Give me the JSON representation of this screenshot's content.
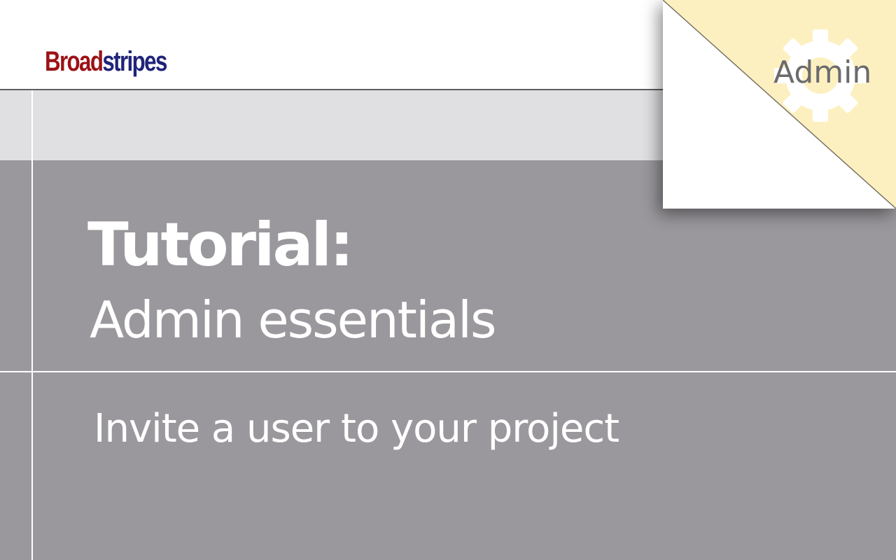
{
  "brand": {
    "logo_part1": "Broad",
    "logo_part2": "stripes",
    "logo_part1_color": "#9c1216",
    "logo_part2_color": "#1f237a"
  },
  "slide": {
    "title": "Tutorial:",
    "title_sub": "Admin essentials",
    "subtitle": "Invite a user to your project"
  },
  "corner_badge": {
    "label": "Admin",
    "icon": "gear-icon",
    "accent_color": "#fdf0c0"
  },
  "colors": {
    "panel": "#9a989c",
    "band": "#e0e0e3",
    "text_on_panel": "#ffffff"
  }
}
